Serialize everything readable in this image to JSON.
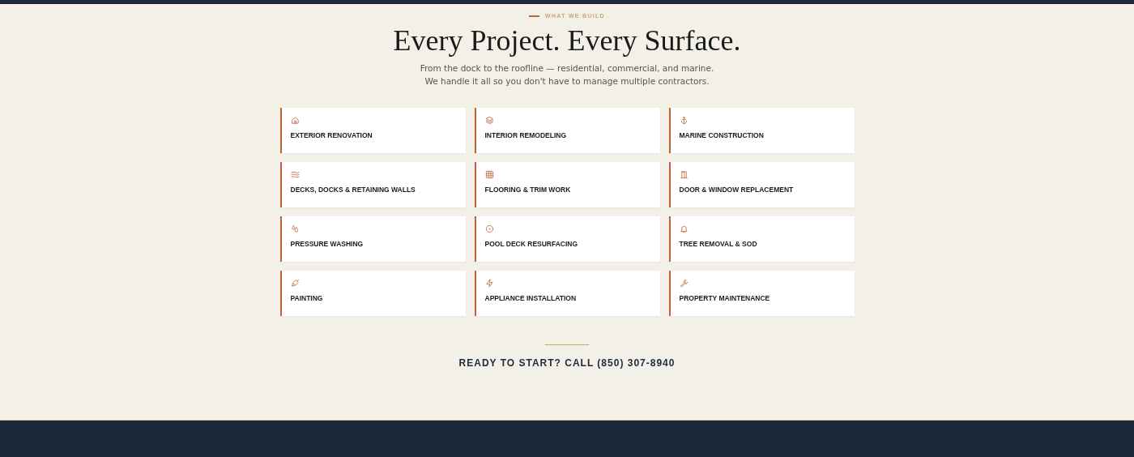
{
  "eyebrow": "WHAT WE BUILD",
  "title": "Every Project. Every Surface.",
  "intro": "From the dock to the roofline — residential, commercial, and marine. We handle it all so you don't have to manage multiple contractors.",
  "services": [
    {
      "label": "EXTERIOR RENOVATION"
    },
    {
      "label": "INTERIOR REMODELING"
    },
    {
      "label": "MARINE CONSTRUCTION"
    },
    {
      "label": "DECKS, DOCKS & RETAINING WALLS"
    },
    {
      "label": "FLOORING & TRIM WORK"
    },
    {
      "label": "DOOR & WINDOW REPLACEMENT"
    },
    {
      "label": "PRESSURE WASHING"
    },
    {
      "label": "POOL DECK RESURFACING"
    },
    {
      "label": "TREE REMOVAL & SOD"
    },
    {
      "label": "PAINTING"
    },
    {
      "label": "APPLIANCE INSTALLATION"
    },
    {
      "label": "PROPERTY MAINTENANCE"
    }
  ],
  "cta": "READY TO START? CALL (850) 307-8940"
}
